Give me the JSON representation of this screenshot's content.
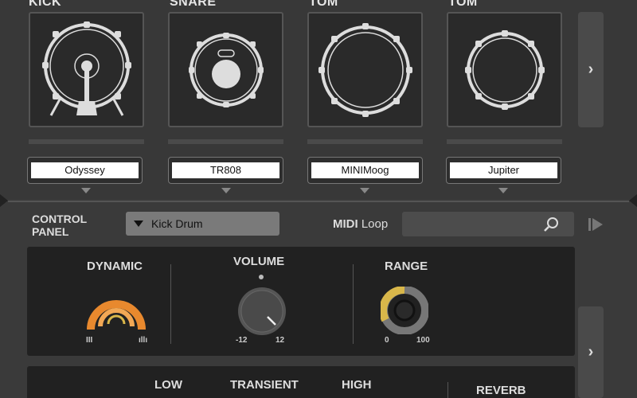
{
  "drums": [
    {
      "label": "KICK",
      "preset": "Odyssey",
      "icon": "kick-drum-icon"
    },
    {
      "label": "SNARE",
      "preset": "TR808",
      "icon": "snare-drum-icon"
    },
    {
      "label": "TOM",
      "preset": "MINIMoog",
      "icon": "tom-drum-icon"
    },
    {
      "label": "TOM",
      "preset": "Jupiter",
      "icon": "tom-drum-icon"
    }
  ],
  "control_panel": {
    "title_line1": "CONTROL",
    "title_line2": "PANEL",
    "selected": "Kick Drum",
    "midi_bold": "MIDI",
    "midi_rest": " Loop"
  },
  "knobs": {
    "dynamic": {
      "title": "DYNAMIC",
      "min_glyph": "III",
      "max_glyph": "ıllı"
    },
    "volume": {
      "title": "VOLUME",
      "min": "-12",
      "max": "12"
    },
    "range": {
      "title": "RANGE",
      "min": "0",
      "max": "100",
      "value_percent": 30
    }
  },
  "lower_panel": {
    "low": "LOW",
    "transient": "TRANSIENT",
    "high": "HIGH",
    "reverb": "REVERB"
  },
  "colors": {
    "accent_orange": "#e8892e",
    "accent_yellow": "#d9b74a"
  }
}
